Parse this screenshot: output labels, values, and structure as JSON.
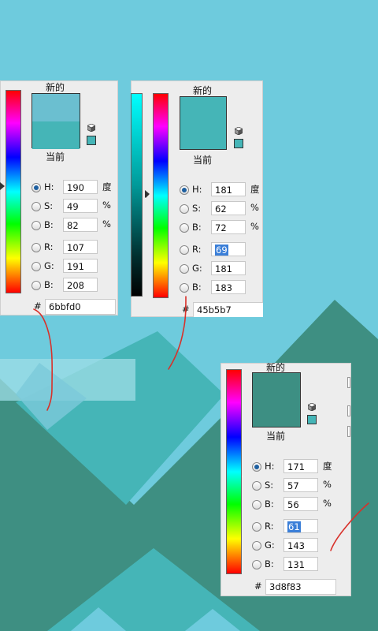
{
  "labels": {
    "new": "新的",
    "current": "当前",
    "hash": "#",
    "degree": "度",
    "percent": "%"
  },
  "panel1": {
    "new_color": "#6bbfd0",
    "current_color": "#45b5b7",
    "h": {
      "name": "H:",
      "value": "190"
    },
    "s": {
      "name": "S:",
      "value": "49"
    },
    "b": {
      "name": "B:",
      "value": "82"
    },
    "r": {
      "name": "R:",
      "value": "107"
    },
    "g": {
      "name": "G:",
      "value": "191"
    },
    "bb": {
      "name": "B:",
      "value": "208"
    },
    "hex": "6bbfd0"
  },
  "panel2": {
    "new_color": "#45b5b7",
    "h": {
      "name": "H:",
      "value": "181"
    },
    "s": {
      "name": "S:",
      "value": "62"
    },
    "b": {
      "name": "B:",
      "value": "72"
    },
    "r": {
      "name": "R:",
      "value": "69"
    },
    "g": {
      "name": "G:",
      "value": "181"
    },
    "bb": {
      "name": "B:",
      "value": "183"
    },
    "hex": "45b5b7"
  },
  "panel3": {
    "new_color": "#3d8f83",
    "h": {
      "name": "H:",
      "value": "171"
    },
    "s": {
      "name": "S:",
      "value": "57"
    },
    "b": {
      "name": "B:",
      "value": "56"
    },
    "r": {
      "name": "R:",
      "value": "61"
    },
    "g": {
      "name": "G:",
      "value": "143"
    },
    "bb": {
      "name": "B:",
      "value": "131"
    },
    "hex": "3d8f83"
  },
  "colors": {
    "sky": "#6ECBDD",
    "teal_dark": "#3E8F82",
    "teal_mid": "#45B5B7",
    "annotation": "#D8312A"
  }
}
